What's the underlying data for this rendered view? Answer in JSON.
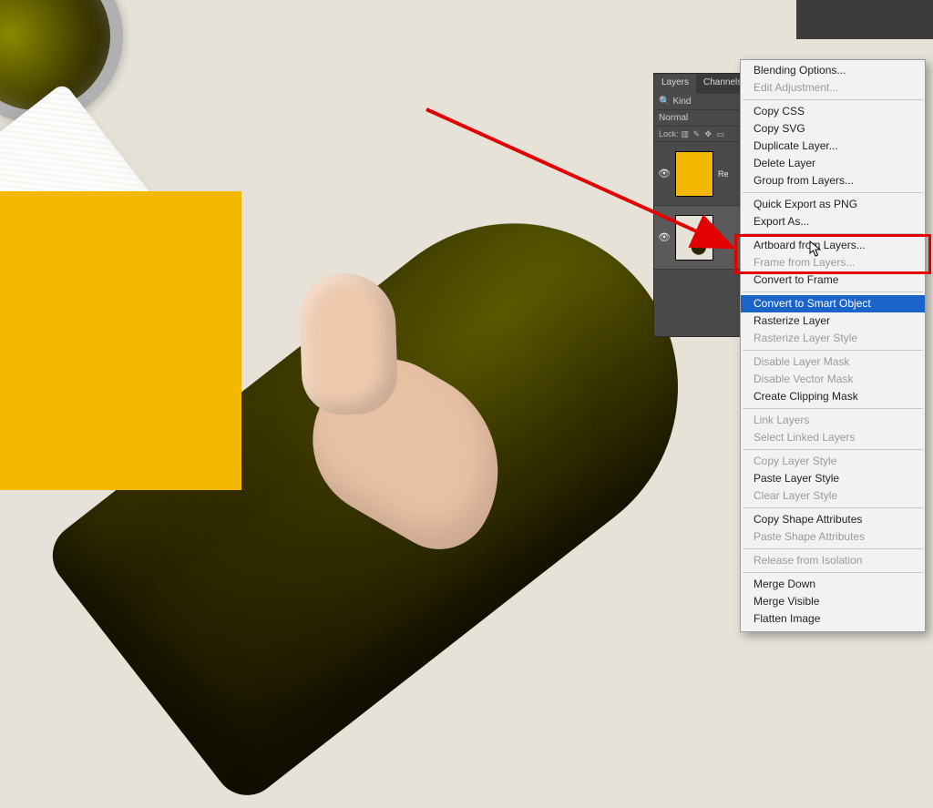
{
  "layers_panel": {
    "tabs": [
      {
        "label": "Layers",
        "active": true
      },
      {
        "label": "Channels",
        "active": false
      }
    ],
    "kind_filter_label": "Kind",
    "blend_row": {
      "mode": "Normal"
    },
    "lock_row_label": "Lock:",
    "layers": [
      {
        "name": "Re",
        "visible": true,
        "thumb": "yellow",
        "selected": false
      },
      {
        "name": "",
        "visible": true,
        "thumb": "bottle",
        "selected": true
      }
    ]
  },
  "context_menu": {
    "groups": [
      [
        {
          "label": "Blending Options...",
          "enabled": true
        },
        {
          "label": "Edit Adjustment...",
          "enabled": false
        }
      ],
      [
        {
          "label": "Copy CSS",
          "enabled": true
        },
        {
          "label": "Copy SVG",
          "enabled": true
        },
        {
          "label": "Duplicate Layer...",
          "enabled": true
        },
        {
          "label": "Delete Layer",
          "enabled": true
        },
        {
          "label": "Group from Layers...",
          "enabled": true
        }
      ],
      [
        {
          "label": "Quick Export as PNG",
          "enabled": true
        },
        {
          "label": "Export As...",
          "enabled": true
        }
      ],
      [
        {
          "label": "Artboard from Layers...",
          "enabled": true
        },
        {
          "label": "Frame from Layers...",
          "enabled": false
        },
        {
          "label": "Convert to Frame",
          "enabled": true
        }
      ],
      [
        {
          "label": "Convert to Smart Object",
          "enabled": true,
          "highlight": true
        },
        {
          "label": "Rasterize Layer",
          "enabled": true
        },
        {
          "label": "Rasterize Layer Style",
          "enabled": false
        }
      ],
      [
        {
          "label": "Disable Layer Mask",
          "enabled": false
        },
        {
          "label": "Disable Vector Mask",
          "enabled": false
        },
        {
          "label": "Create Clipping Mask",
          "enabled": true
        }
      ],
      [
        {
          "label": "Link Layers",
          "enabled": false
        },
        {
          "label": "Select Linked Layers",
          "enabled": false
        }
      ],
      [
        {
          "label": "Copy Layer Style",
          "enabled": false
        },
        {
          "label": "Paste Layer Style",
          "enabled": true
        },
        {
          "label": "Clear Layer Style",
          "enabled": false
        }
      ],
      [
        {
          "label": "Copy Shape Attributes",
          "enabled": true
        },
        {
          "label": "Paste Shape Attributes",
          "enabled": false
        }
      ],
      [
        {
          "label": "Release from Isolation",
          "enabled": false
        }
      ],
      [
        {
          "label": "Merge Down",
          "enabled": true
        },
        {
          "label": "Merge Visible",
          "enabled": true
        },
        {
          "label": "Flatten Image",
          "enabled": true
        }
      ]
    ]
  },
  "annotation": {
    "color": "#e20000",
    "target_label": "Convert to Smart Object"
  }
}
